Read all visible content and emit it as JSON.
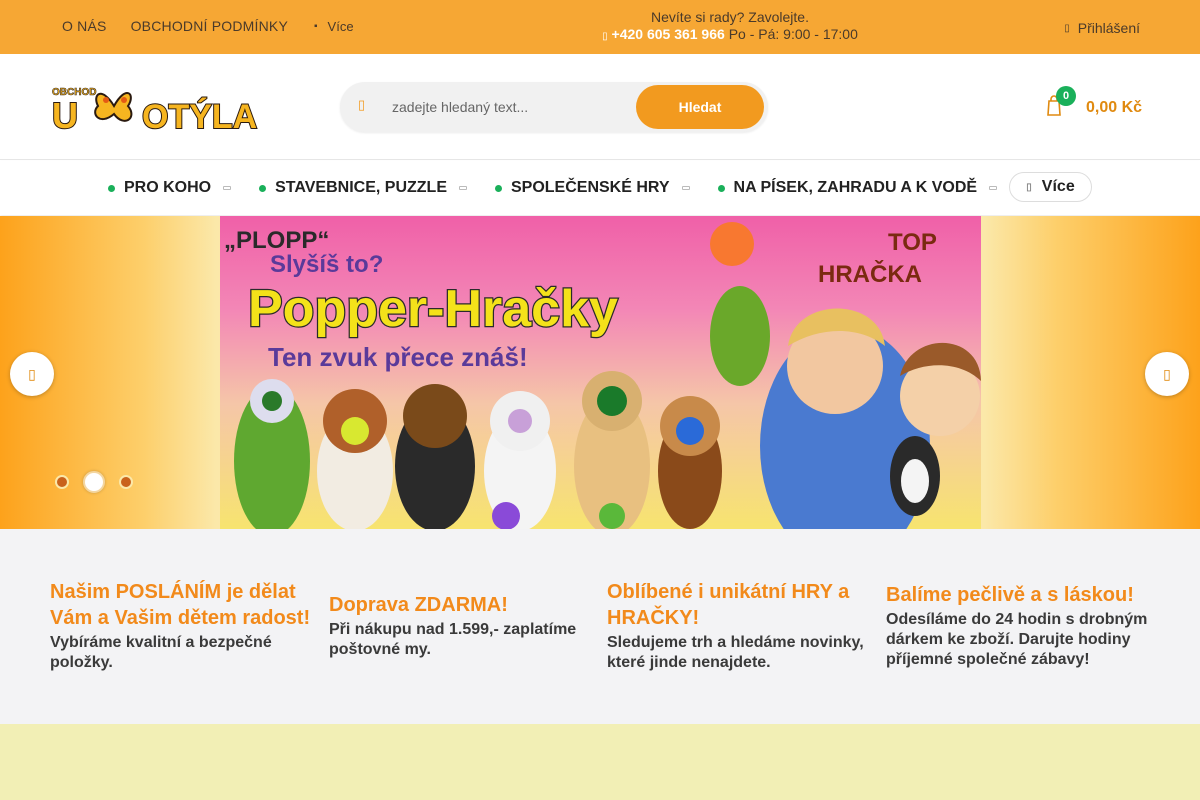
{
  "topbar": {
    "links": [
      "O NÁS",
      "OBCHODNÍ PODMÍNKY"
    ],
    "more_label": "Více",
    "contact_line": "Nevíte si rady? Zavolejte.",
    "phone": "+420 605 361 966",
    "hours": "Po - Pá: 9:00 - 17:00",
    "login_label": "Přihlášení"
  },
  "header": {
    "logo_small": "OBCHOD",
    "logo_text": "U MOTÝLA",
    "search_placeholder": "zadejte hledaný text...",
    "search_button": "Hledat",
    "cart_count": "0",
    "cart_total": "0,00 Kč"
  },
  "nav": {
    "items": [
      {
        "label": "PRO KOHO"
      },
      {
        "label": "STAVEBNICE, PUZZLE"
      },
      {
        "label": "SPOLEČENSKÉ HRY"
      },
      {
        "label": "NA PÍSEK, ZAHRADU A K VODĚ"
      }
    ],
    "more_label": "Více"
  },
  "banner": {
    "plopp": "„PLOPP“",
    "slysis": "Slyšíš to?",
    "title": "Popper-Hračky",
    "subtitle": "Ten zvuk přece znáš!",
    "top_badge_1": "TOP",
    "top_badge_2": "HRAČKA",
    "slides": 3,
    "active_slide": 2
  },
  "features": [
    {
      "title": "Našim POSLÁNÍM je dělat Vám a Vašim dětem radost!",
      "text": "Vybíráme kvalitní a bezpečné položky."
    },
    {
      "title": "Doprava ZDARMA!",
      "text": "Při nákupu nad 1.599,- zaplatíme poštovné my."
    },
    {
      "title": "Oblíbené i unikátní HRY a HRAČKY!",
      "text": "Sledujeme trh a hledáme novinky, které jinde nenajdete."
    },
    {
      "title": "Balíme pečlivě a s láskou!",
      "text": "Odesíláme do 24 hodin s drobným dárkem ke zboží. Darujte hodiny příjemné společné zábavy!"
    }
  ],
  "colors": {
    "accent": "#f6a734",
    "button": "#f29a1f",
    "green": "#1ab05a",
    "feature_title": "#f28a1b"
  }
}
